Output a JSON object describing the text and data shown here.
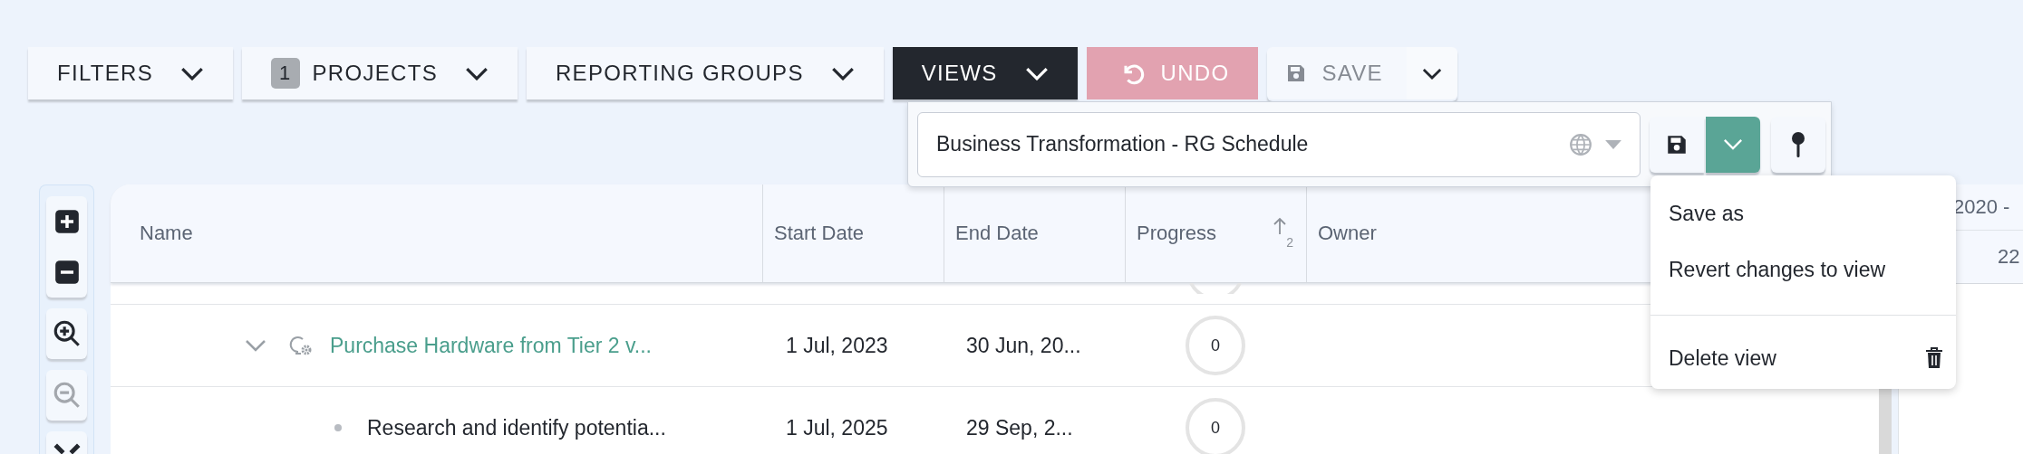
{
  "toolbar": [
    {
      "kind": "dropdown",
      "label": "FILTERS",
      "expanded": false
    },
    {
      "kind": "dropdown",
      "label": "PROJECTS",
      "badge": "1",
      "expanded": false
    },
    {
      "kind": "dropdown",
      "label": "REPORTING GROUPS",
      "expanded": false
    },
    {
      "kind": "dropdown",
      "label": "VIEWS",
      "expanded": true
    },
    {
      "kind": "undo",
      "label": "UNDO",
      "disabled": false
    },
    {
      "kind": "split",
      "label": "SAVE",
      "disabled": true
    }
  ],
  "views_panel": {
    "view_select": {
      "value": "Business Transformation - RG Schedule"
    },
    "menu_expanded": true
  },
  "views_menu": [
    {
      "kind": "item",
      "label": "Save as"
    },
    {
      "kind": "item",
      "label": "Revert changes to view"
    },
    {
      "kind": "delete",
      "label": "Delete view"
    }
  ],
  "zoom_tools": [
    {
      "kind": "plus",
      "disabled": false
    },
    {
      "kind": "minus",
      "disabled": false
    },
    {
      "kind": "zoom_in",
      "disabled": false
    },
    {
      "kind": "zoom_out",
      "disabled": true
    },
    {
      "kind": "fit",
      "disabled": false
    }
  ],
  "table": {
    "columns": [
      {
        "label": "Name"
      },
      {
        "label": "Start Date"
      },
      {
        "label": "End Date"
      },
      {
        "label": "Progress",
        "sort": {
          "order": "2"
        }
      },
      {
        "label": "Owner"
      }
    ],
    "rows": [
      {
        "name": "Purchase Hardware from Tier 2 v...",
        "start": "1 Jul, 2023",
        "end": "30 Jun, 20...",
        "progress": "0",
        "expanded": true,
        "children": [
          {
            "name": "Research and identify potentia...",
            "start": "1 Jul, 2025",
            "end": "29 Sep, 2...",
            "progress": "0"
          }
        ]
      }
    ]
  },
  "gantt": {
    "period": "2020 -",
    "columns": [
      "22"
    ]
  }
}
